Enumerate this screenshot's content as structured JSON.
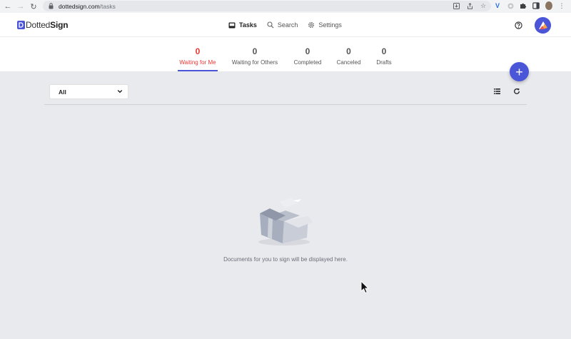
{
  "browser": {
    "url_domain": "dottedsign.com",
    "url_path": "/tasks"
  },
  "app": {
    "logo_dotted": "Dotted",
    "logo_sign": "Sign"
  },
  "nav": {
    "tasks": "Tasks",
    "search": "Search",
    "settings": "Settings"
  },
  "status_tabs": [
    {
      "count": "0",
      "label": "Waiting for Me",
      "active": true
    },
    {
      "count": "0",
      "label": "Waiting for Others"
    },
    {
      "count": "0",
      "label": "Completed"
    },
    {
      "count": "0",
      "label": "Canceled"
    },
    {
      "count": "0",
      "label": "Drafts"
    }
  ],
  "fab_label": "+",
  "filter": {
    "selected": "All"
  },
  "empty_state": {
    "message": "Documents for you to sign will be displayed here."
  },
  "colors": {
    "accent": "#4a55d8",
    "active_tab_text": "#e53935",
    "background": "#e9eaee"
  }
}
